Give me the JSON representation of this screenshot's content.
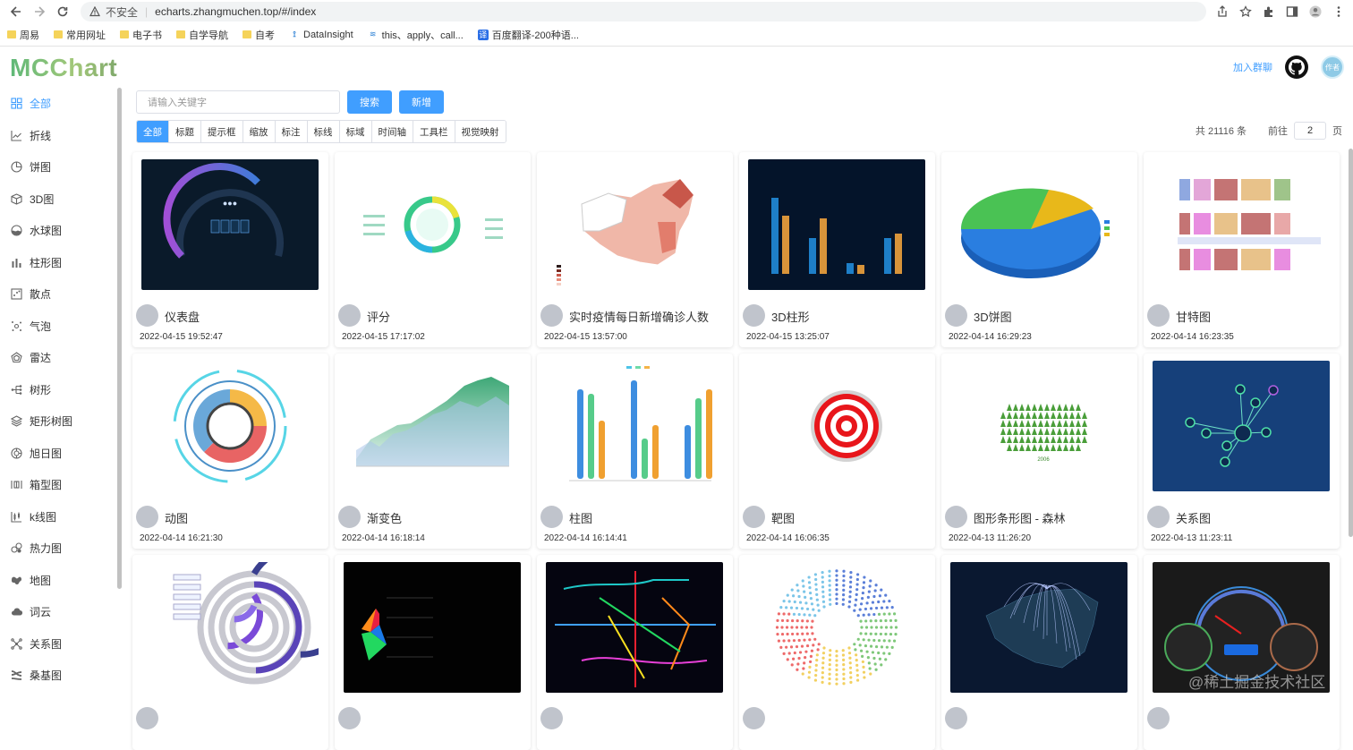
{
  "browser": {
    "insecure_label": "不安全",
    "url": "echarts.zhangmuchen.top/#/index",
    "bookmarks": [
      "周易",
      "常用网址",
      "电子书",
      "自学导航",
      "自考",
      "DataInsight",
      "this、apply、call...",
      "百度翻译-200种语..."
    ]
  },
  "header": {
    "logo": "MCChart",
    "join_link": "加入群聊",
    "avatar_text": "作者"
  },
  "sidebar": {
    "items": [
      {
        "label": "全部",
        "icon": "grid-icon",
        "active": true
      },
      {
        "label": "折线",
        "icon": "line-chart-icon"
      },
      {
        "label": "饼图",
        "icon": "pie-chart-icon"
      },
      {
        "label": "3D图",
        "icon": "cube-icon"
      },
      {
        "label": "水球图",
        "icon": "liquid-ball-icon"
      },
      {
        "label": "柱形图",
        "icon": "bar-chart-icon"
      },
      {
        "label": "散点",
        "icon": "scatter-icon"
      },
      {
        "label": "气泡",
        "icon": "bubble-icon"
      },
      {
        "label": "雷达",
        "icon": "radar-icon"
      },
      {
        "label": "树形",
        "icon": "tree-icon"
      },
      {
        "label": "矩形树图",
        "icon": "layers-icon"
      },
      {
        "label": "旭日图",
        "icon": "sunburst-icon"
      },
      {
        "label": "箱型图",
        "icon": "boxplot-icon"
      },
      {
        "label": "k线图",
        "icon": "candlestick-icon"
      },
      {
        "label": "热力图",
        "icon": "heatmap-icon"
      },
      {
        "label": "地图",
        "icon": "map-icon"
      },
      {
        "label": "词云",
        "icon": "cloud-icon"
      },
      {
        "label": "关系图",
        "icon": "graph-icon"
      },
      {
        "label": "桑基图",
        "icon": "sankey-icon"
      }
    ]
  },
  "search": {
    "placeholder": "请输入关键字",
    "search_label": "搜索",
    "add_label": "新增"
  },
  "tabs": [
    "全部",
    "标题",
    "提示框",
    "缩放",
    "标注",
    "标线",
    "标域",
    "时间轴",
    "工具栏",
    "视觉映射"
  ],
  "pager": {
    "total": "共 21116 条",
    "goto_label": "前往",
    "page": "2",
    "page_suffix": "页"
  },
  "cards": [
    {
      "title": "仪表盘",
      "date": "2022-04-15 19:52:47",
      "thumb": "gauge"
    },
    {
      "title": "评分",
      "date": "2022-04-15 17:17:02",
      "thumb": "rating"
    },
    {
      "title": "实时疫情每日新增确诊人数",
      "date": "2022-04-15 13:57:00",
      "thumb": "china-map"
    },
    {
      "title": "3D柱形",
      "date": "2022-04-15 13:25:07",
      "thumb": "bar3d"
    },
    {
      "title": "3D饼图",
      "date": "2022-04-14 16:29:23",
      "thumb": "pie3d"
    },
    {
      "title": "甘特图",
      "date": "2022-04-14 16:23:35",
      "thumb": "gantt"
    },
    {
      "title": "动图",
      "date": "2022-04-14 16:21:30",
      "thumb": "ring"
    },
    {
      "title": "渐变色",
      "date": "2022-04-14 16:18:14",
      "thumb": "area"
    },
    {
      "title": "柱图",
      "date": "2022-04-14 16:14:41",
      "thumb": "bars"
    },
    {
      "title": "靶图",
      "date": "2022-04-14 16:06:35",
      "thumb": "target"
    },
    {
      "title": "图形条形图 - 森林",
      "date": "2022-04-13 11:26:20",
      "thumb": "forest"
    },
    {
      "title": "关系图",
      "date": "2022-04-13 11:23:11",
      "thumb": "graph"
    },
    {
      "title": "",
      "date": "",
      "thumb": "circles"
    },
    {
      "title": "",
      "date": "",
      "thumb": "dark-funnel"
    },
    {
      "title": "",
      "date": "",
      "thumb": "metro"
    },
    {
      "title": "",
      "date": "",
      "thumb": "dots-ring"
    },
    {
      "title": "",
      "date": "",
      "thumb": "flight-map"
    },
    {
      "title": "",
      "date": "",
      "thumb": "speedometer"
    }
  ],
  "watermark": "@稀土掘金技术社区"
}
